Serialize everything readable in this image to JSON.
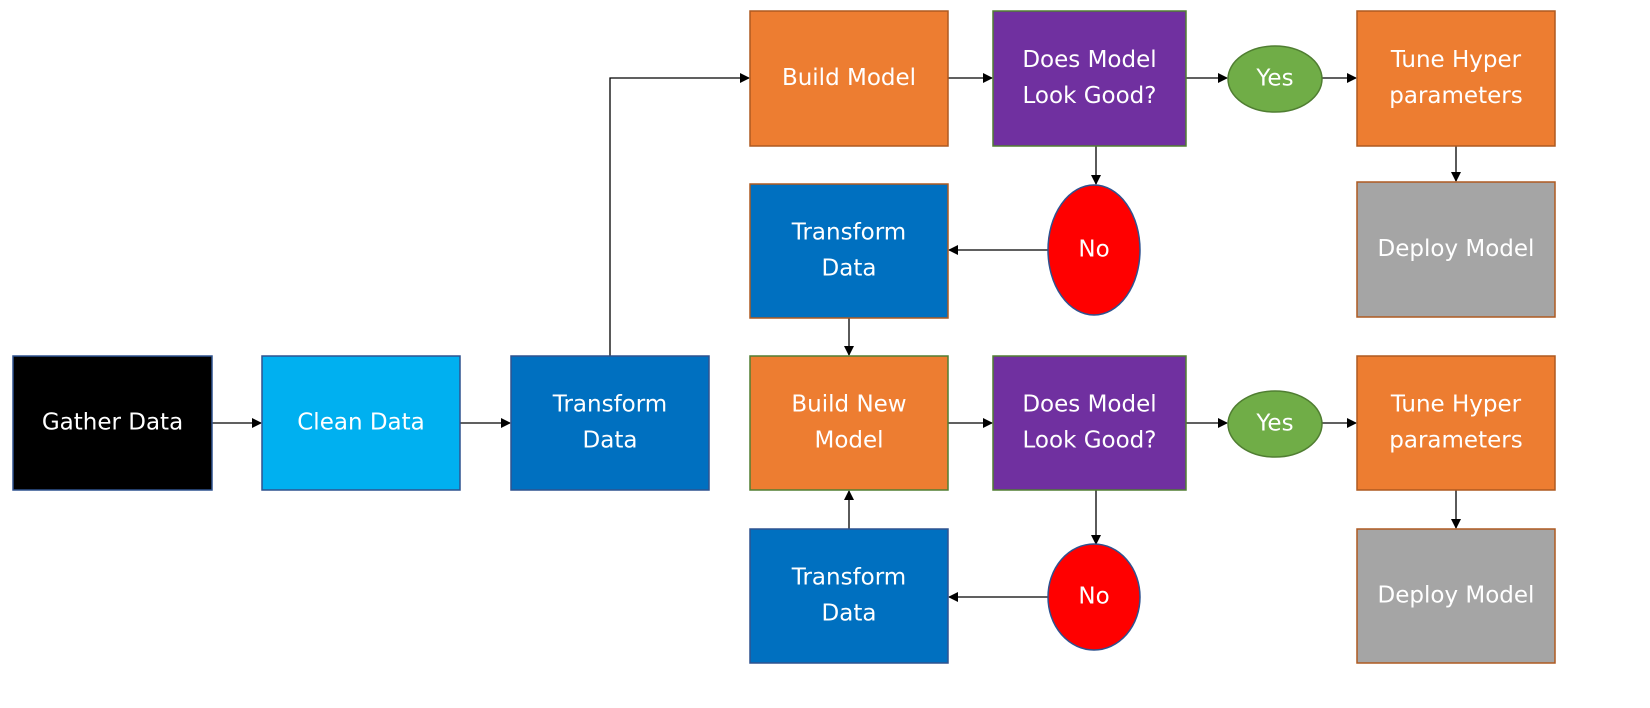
{
  "colors": {
    "gather": "#000000",
    "clean": "#00B0F0",
    "transform": "#0070C0",
    "build": "#ED7D31",
    "decision": "#7030A0",
    "yes": "#70AD47",
    "no": "#FF0000",
    "deploy": "#A5A5A5"
  },
  "nodes": {
    "gather": [
      "Gather Data"
    ],
    "clean": [
      "Clean Data"
    ],
    "transform_main": [
      "Transform",
      "Data"
    ],
    "build_model": [
      "Build Model"
    ],
    "decision_top": [
      "Does Model",
      "Look Good?"
    ],
    "yes_top": [
      "Yes"
    ],
    "tune_top": [
      "Tune Hyper",
      "parameters"
    ],
    "deploy_top": [
      "Deploy Model"
    ],
    "no_top": [
      "No"
    ],
    "transform_mid": [
      "Transform",
      "Data"
    ],
    "build_new": [
      "Build New",
      "Model"
    ],
    "decision_bottom": [
      "Does Model",
      "Look Good?"
    ],
    "yes_bottom": [
      "Yes"
    ],
    "tune_bottom": [
      "Tune Hyper",
      "parameters"
    ],
    "deploy_bottom": [
      "Deploy Model"
    ],
    "no_bottom": [
      "No"
    ],
    "transform_bottom": [
      "Transform",
      "Data"
    ]
  }
}
